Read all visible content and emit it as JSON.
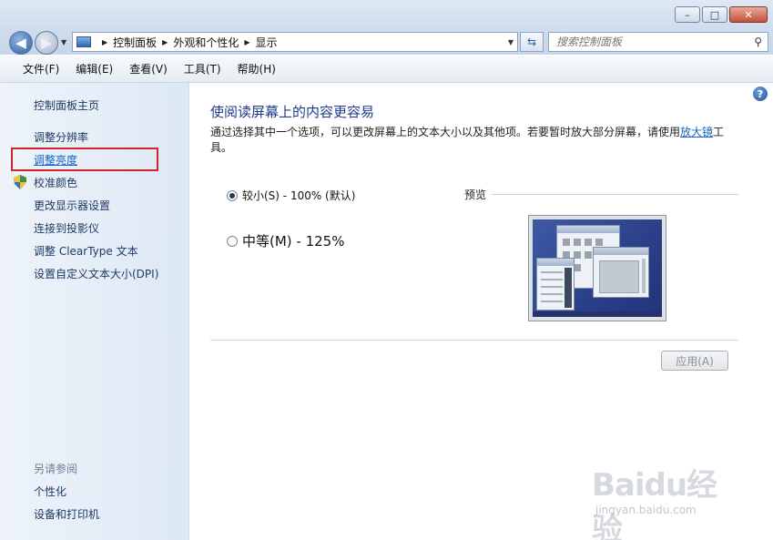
{
  "window": {
    "minimize_glyph": "–",
    "maximize_glyph": "□",
    "close_glyph": "✕"
  },
  "address": {
    "crumbs": [
      "控制面板",
      "外观和个性化",
      "显示"
    ],
    "search_placeholder": "搜索控制面板"
  },
  "menu": {
    "items": [
      "文件(F)",
      "编辑(E)",
      "查看(V)",
      "工具(T)",
      "帮助(H)"
    ]
  },
  "sidebar": {
    "home": "控制面板主页",
    "links": [
      "调整分辨率",
      "调整亮度",
      "校准颜色",
      "更改显示器设置",
      "连接到投影仪",
      "调整 ClearType 文本",
      "设置自定义文本大小(DPI)"
    ],
    "see_also_title": "另请参阅",
    "see_also": [
      "个性化",
      "设备和打印机"
    ],
    "highlight_color": "#d0242a"
  },
  "main": {
    "heading": "使阅读屏幕上的内容更容易",
    "desc_before": "通过选择其中一个选项，可以更改屏幕上的文本大小以及其他项。若要暂时放大部分屏幕，请使用",
    "desc_link": "放大镜",
    "desc_after": "工具。",
    "option_small": "较小(S) - 100% (默认)",
    "option_medium": "中等(M) - 125%",
    "selected_option": "small",
    "preview_label": "预览",
    "apply_button": "应用(A)"
  },
  "watermark": {
    "brand": "Baidu经验",
    "url": "jingyan.baidu.com"
  },
  "icons": {
    "back": "back-arrow-icon",
    "forward": "forward-arrow-icon",
    "refresh": "refresh-icon",
    "search": "search-icon",
    "help": "help-icon",
    "shield": "uac-shield-icon"
  }
}
